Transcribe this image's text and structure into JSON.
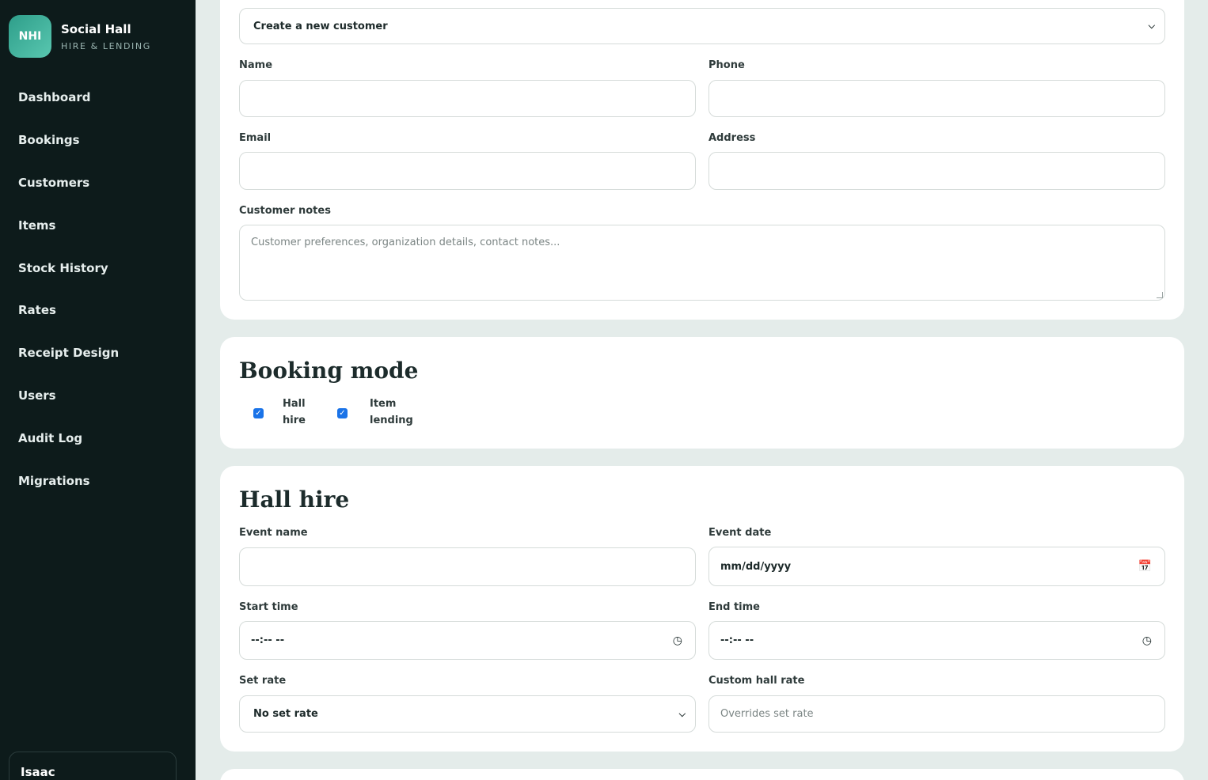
{
  "brand": {
    "logo_text": "NHI",
    "name": "Social Hall",
    "subtitle": "HIRE & LENDING"
  },
  "sidebar": {
    "items": [
      {
        "label": "Dashboard"
      },
      {
        "label": "Bookings"
      },
      {
        "label": "Customers"
      },
      {
        "label": "Items"
      },
      {
        "label": "Stock History"
      },
      {
        "label": "Rates"
      },
      {
        "label": "Receipt Design"
      },
      {
        "label": "Users"
      },
      {
        "label": "Audit Log"
      },
      {
        "label": "Migrations"
      }
    ],
    "user": {
      "name": "Isaac"
    }
  },
  "customer": {
    "select_value": "Create a new customer",
    "name_label": "Name",
    "phone_label": "Phone",
    "email_label": "Email",
    "address_label": "Address",
    "notes_label": "Customer notes",
    "notes_placeholder": "Customer preferences, organization details, contact notes..."
  },
  "booking_mode": {
    "title": "Booking mode",
    "options": [
      {
        "label": "Hall hire",
        "checked": true
      },
      {
        "label": "Item lending",
        "checked": true
      }
    ]
  },
  "hall_hire": {
    "title": "Hall hire",
    "event_name_label": "Event name",
    "event_date_label": "Event date",
    "event_date_value": "mm/dd/yyyy",
    "start_time_label": "Start time",
    "start_time_value": "--:-- --",
    "end_time_label": "End time",
    "end_time_value": "--:-- --",
    "set_rate_label": "Set rate",
    "set_rate_value": "No set rate",
    "custom_rate_label": "Custom hall rate",
    "custom_rate_placeholder": "Overrides set rate"
  }
}
